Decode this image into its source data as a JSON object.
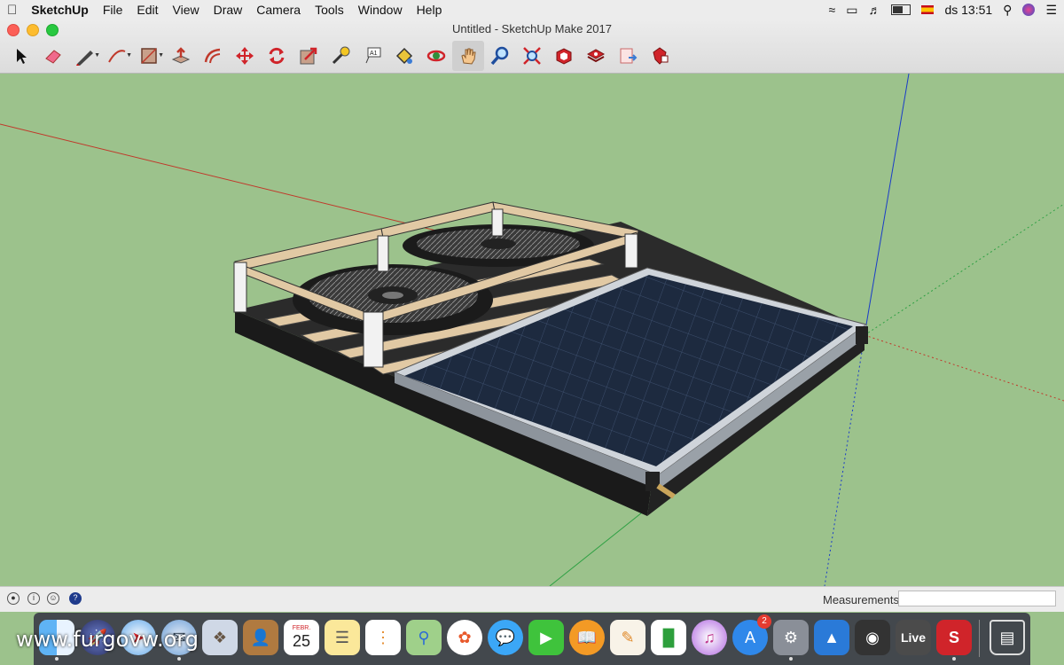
{
  "menubar": {
    "app_name": "SketchUp",
    "items": [
      "File",
      "Edit",
      "View",
      "Draw",
      "Camera",
      "Tools",
      "Window",
      "Help"
    ],
    "clock": "ds 13:51"
  },
  "window": {
    "title": "Untitled - SketchUp Make 2017"
  },
  "toolbar": {
    "tools": [
      "select",
      "eraser",
      "line",
      "arc",
      "shapes",
      "push-pull",
      "offset",
      "move",
      "rotate",
      "scale",
      "tape-measure",
      "text",
      "paint-bucket",
      "orbit",
      "pan",
      "zoom",
      "zoom-extents",
      "warehouse",
      "extension-warehouse",
      "send-to-layout",
      "extension-manager"
    ]
  },
  "status": {
    "measurements_label": "Measurements",
    "measurements_value": ""
  },
  "dock": {
    "apps": [
      "finder",
      "launchpad",
      "safari",
      "mail",
      "contacts",
      "calendar",
      "notes",
      "reminders",
      "maps",
      "photos",
      "messages",
      "facetime",
      "ibooks",
      "pages",
      "numbers",
      "itunes",
      "app-store",
      "system-preferences",
      "keynote",
      "dvd-player",
      "live",
      "sketchup",
      "trash"
    ],
    "calendar_day": "25",
    "calendar_month": "FEBR.",
    "app_store_badge": "2",
    "live_label": "Live"
  },
  "watermark": "www.furgovw.org",
  "colors": {
    "ground": "#9cc28c",
    "axis_red": "#c0392b",
    "axis_green": "#2ea043",
    "axis_blue": "#1a3cc8"
  }
}
